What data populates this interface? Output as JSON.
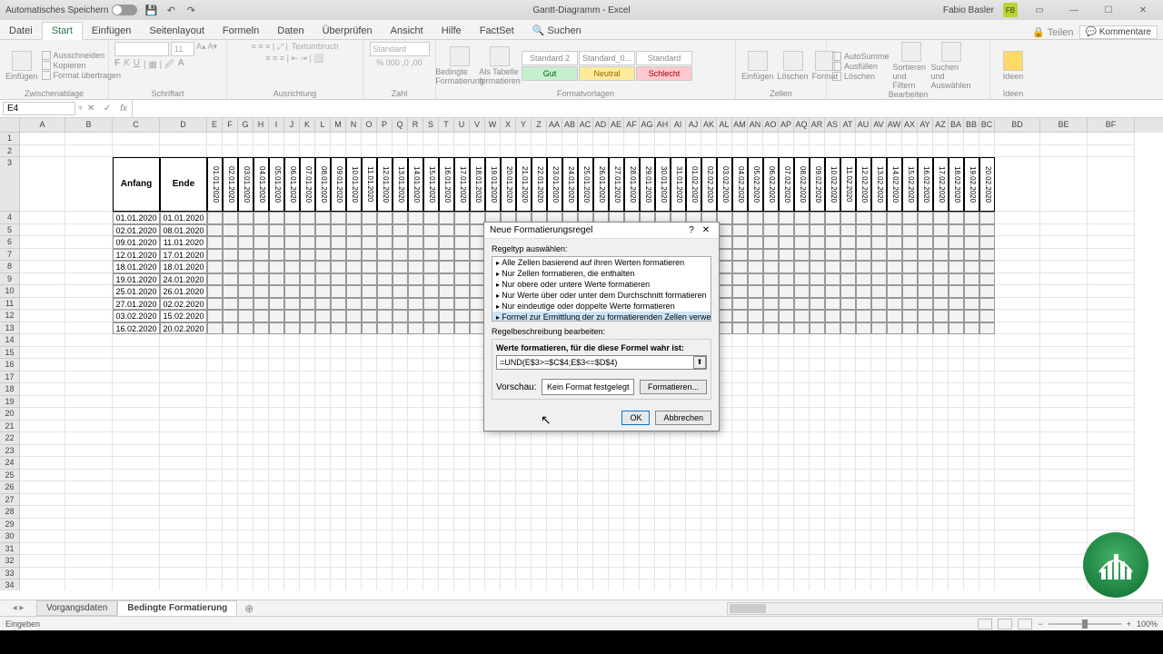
{
  "title": "Gantt-Diagramm - Excel",
  "autosave_label": "Automatisches Speichern",
  "user_name": "Fabio Basler",
  "user_initials": "FB",
  "tabs": [
    "Datei",
    "Start",
    "Einfügen",
    "Seitenlayout",
    "Formeln",
    "Daten",
    "Überprüfen",
    "Ansicht",
    "Hilfe",
    "FactSet"
  ],
  "search_label": "Suchen",
  "share_label": "Teilen",
  "comments_label": "Kommentare",
  "ribbon": {
    "clipboard": {
      "label": "Zwischenablage",
      "paste": "Einfügen",
      "cut": "Ausschneiden",
      "copy": "Kopieren",
      "painter": "Format übertragen"
    },
    "font": {
      "label": "Schriftart",
      "size": "11"
    },
    "align": {
      "label": "Ausrichtung",
      "wrap": "Textumbruch"
    },
    "number": {
      "label": "Zahl",
      "format": "Standard"
    },
    "styles": {
      "label": "Formatvorlagen",
      "cond": "Bedingte Formatierung",
      "table": "Als Tabelle formatieren",
      "s1": "Standard 2",
      "s2": "Standard_0...",
      "s3": "Standard",
      "s4": "Gut",
      "s5": "Neutral",
      "s6": "Schlecht"
    },
    "cells": {
      "label": "Zellen",
      "insert": "Einfügen",
      "delete": "Löschen",
      "format": "Format"
    },
    "editing": {
      "label": "Bearbeiten",
      "sum": "AutoSumme",
      "fill": "Ausfüllen",
      "clear": "Löschen",
      "sort": "Sortieren und Filtern",
      "find": "Suchen und Auswählen"
    },
    "ideas": {
      "label": "Ideen",
      "btn": "Ideen"
    }
  },
  "name_box": "E4",
  "col_letters_wide": [
    "A",
    "B",
    "C",
    "D"
  ],
  "col_letters_narrow": [
    "E",
    "F",
    "G",
    "H",
    "I",
    "J",
    "K",
    "L",
    "M",
    "N",
    "O",
    "P",
    "Q",
    "R",
    "S",
    "T",
    "U",
    "V",
    "W",
    "X",
    "Y",
    "Z",
    "AA",
    "AB",
    "AC",
    "AD",
    "AE",
    "AF",
    "AG",
    "AH",
    "AI",
    "AJ",
    "AK",
    "AL",
    "AM",
    "AN",
    "AO",
    "AP",
    "AQ",
    "AR",
    "AS",
    "AT",
    "AU",
    "AV",
    "AW",
    "AX",
    "AY",
    "AZ",
    "BA",
    "BB",
    "BC"
  ],
  "col_letters_end": [
    "BD",
    "BE",
    "BF"
  ],
  "headers": {
    "anfang": "Anfang",
    "ende": "Ende"
  },
  "date_cols": [
    "01.01.2020",
    "02.01.2020",
    "03.01.2020",
    "04.01.2020",
    "05.01.2020",
    "06.01.2020",
    "07.01.2020",
    "08.01.2020",
    "09.01.2020",
    "10.01.2020",
    "11.01.2020",
    "12.01.2020",
    "13.01.2020",
    "14.01.2020",
    "15.01.2020",
    "16.01.2020",
    "17.01.2020",
    "18.01.2020",
    "19.01.2020",
    "20.01.2020",
    "21.01.2020",
    "22.01.2020",
    "23.01.2020",
    "24.01.2020",
    "25.01.2020",
    "26.01.2020",
    "27.01.2020",
    "28.01.2020",
    "29.01.2020",
    "30.01.2020",
    "31.01.2020",
    "01.02.2020",
    "02.02.2020",
    "03.02.2020",
    "04.02.2020",
    "05.02.2020",
    "06.02.2020",
    "07.02.2020",
    "08.02.2020",
    "09.02.2020",
    "10.02.2020",
    "11.02.2020",
    "12.02.2020",
    "13.02.2020",
    "14.02.2020",
    "15.02.2020",
    "16.02.2020",
    "17.02.2020",
    "18.02.2020",
    "19.02.2020",
    "20.02.2020"
  ],
  "tasks": [
    {
      "start": "01.01.2020",
      "end": "01.01.2020"
    },
    {
      "start": "02.01.2020",
      "end": "08.01.2020"
    },
    {
      "start": "09.01.2020",
      "end": "11.01.2020"
    },
    {
      "start": "12.01.2020",
      "end": "17.01.2020"
    },
    {
      "start": "18.01.2020",
      "end": "18.01.2020"
    },
    {
      "start": "19.01.2020",
      "end": "24.01.2020"
    },
    {
      "start": "25.01.2020",
      "end": "26.01.2020"
    },
    {
      "start": "27.01.2020",
      "end": "02.02.2020"
    },
    {
      "start": "03.02.2020",
      "end": "15.02.2020"
    },
    {
      "start": "16.02.2020",
      "end": "20.02.2020"
    }
  ],
  "dialog": {
    "title": "Neue Formatierungsregel",
    "ruletype_label": "Regeltyp auswählen:",
    "rules": [
      "Alle Zellen basierend auf ihren Werten formatieren",
      "Nur Zellen formatieren, die enthalten",
      "Nur obere oder untere Werte formatieren",
      "Nur Werte über oder unter dem Durchschnitt formatieren",
      "Nur eindeutige oder doppelte Werte formatieren",
      "Formel zur Ermittlung der zu formatierenden Zellen verwenden"
    ],
    "desc_label": "Regelbeschreibung bearbeiten:",
    "formula_label": "Werte formatieren, für die diese Formel wahr ist:",
    "formula_value": "=UND(E$3>=$C$4;E$3<=$D$4)",
    "preview_label": "Vorschau:",
    "preview_text": "Kein Format festgelegt",
    "format_btn": "Formatieren...",
    "ok": "OK",
    "cancel": "Abbrechen"
  },
  "sheets": {
    "nav": "◂ ▸",
    "tab1": "Vorgangsdaten",
    "tab2": "Bedingte Formatierung"
  },
  "status": "Eingeben",
  "zoom": "100%"
}
